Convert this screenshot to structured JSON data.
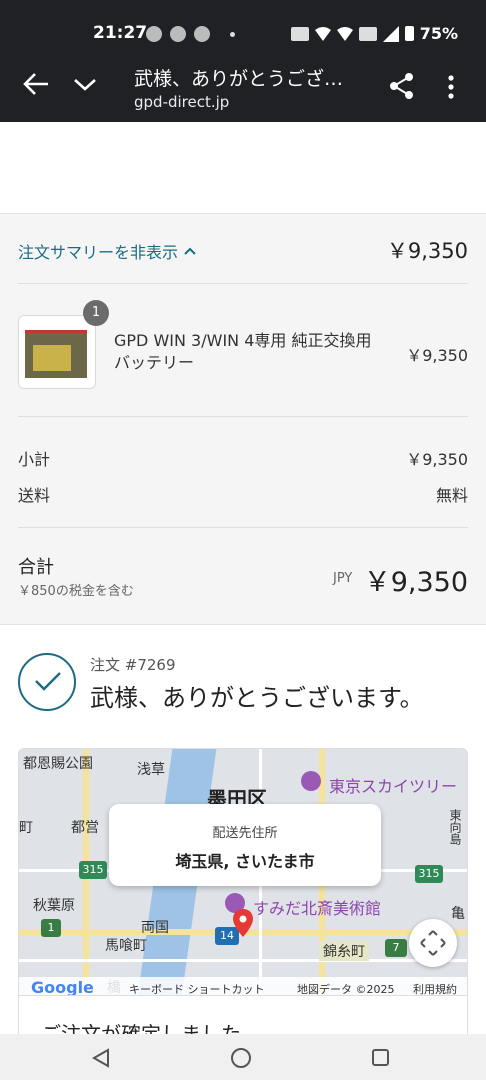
{
  "status": {
    "time": "21:27",
    "battery": "75%"
  },
  "browser": {
    "title": "武様、ありがとうござ…",
    "url": "gpd-direct.jp"
  },
  "summary": {
    "toggle_label": "注文サマリーを非表示",
    "total_top": "￥9,350",
    "item": {
      "quantity": "1",
      "name": "GPD WIN 3/WIN 4専用 純正交換用バッテリー",
      "price": "￥9,350"
    },
    "subtotal_label": "小計",
    "subtotal_value": "￥9,350",
    "shipping_label": "送料",
    "shipping_value": "無料",
    "total_label": "合計",
    "tax_note": "￥850の税金を含む",
    "currency": "JPY",
    "grand_total": "￥9,350"
  },
  "confirmation": {
    "order_number": "注文 #7269",
    "thanks": "武様、ありがとうございます。",
    "confirm_heading": "ご注文が確定しました"
  },
  "map": {
    "popup_title": "配送先住所",
    "popup_address": "埼玉県, さいたま市",
    "labels": {
      "onshi": "都恩賜公園",
      "asakusa": "浅草",
      "sumida": "墨田区",
      "skytree": "東京スカイツリー",
      "akihabara": "秋葉原",
      "ryogoku": "両国",
      "bakurocho": "馬喰町",
      "hokusai": "すみだ北斎美術館",
      "kinshicho": "錦糸町",
      "r315a": "315",
      "r315b": "315",
      "r1": "1",
      "r14": "14",
      "r7": "7",
      "hashi": "橋",
      "higashimukojima": "東向島",
      "kame": "亀",
      "cho": "町",
      "miyako": "都営"
    },
    "keyboard_shortcuts": "キーボード ショートカット",
    "map_data": "地図データ ©2025",
    "terms": "利用規約",
    "google": "Google"
  }
}
